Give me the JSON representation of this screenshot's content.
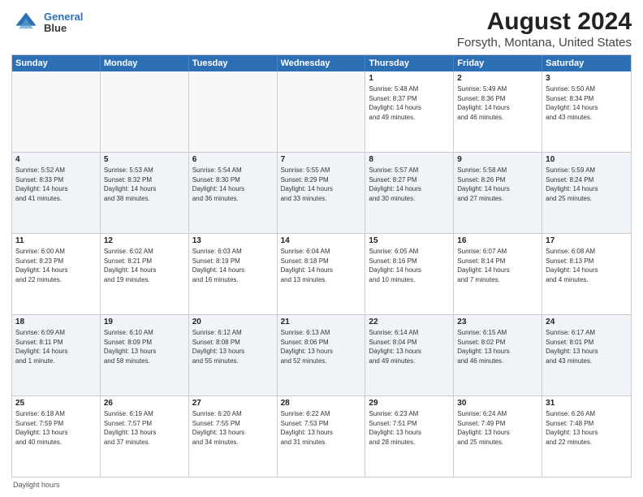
{
  "app": {
    "logo_line1": "General",
    "logo_line2": "Blue"
  },
  "title": "August 2024",
  "subtitle": "Forsyth, Montana, United States",
  "footer_note": "Daylight hours",
  "header_days": [
    "Sunday",
    "Monday",
    "Tuesday",
    "Wednesday",
    "Thursday",
    "Friday",
    "Saturday"
  ],
  "rows": [
    {
      "alt": false,
      "cells": [
        {
          "day": "",
          "empty": true,
          "info": ""
        },
        {
          "day": "",
          "empty": true,
          "info": ""
        },
        {
          "day": "",
          "empty": true,
          "info": ""
        },
        {
          "day": "",
          "empty": true,
          "info": ""
        },
        {
          "day": "1",
          "empty": false,
          "info": "Sunrise: 5:48 AM\nSunset: 8:37 PM\nDaylight: 14 hours\nand 49 minutes."
        },
        {
          "day": "2",
          "empty": false,
          "info": "Sunrise: 5:49 AM\nSunset: 8:36 PM\nDaylight: 14 hours\nand 46 minutes."
        },
        {
          "day": "3",
          "empty": false,
          "info": "Sunrise: 5:50 AM\nSunset: 8:34 PM\nDaylight: 14 hours\nand 43 minutes."
        }
      ]
    },
    {
      "alt": true,
      "cells": [
        {
          "day": "4",
          "empty": false,
          "info": "Sunrise: 5:52 AM\nSunset: 8:33 PM\nDaylight: 14 hours\nand 41 minutes."
        },
        {
          "day": "5",
          "empty": false,
          "info": "Sunrise: 5:53 AM\nSunset: 8:32 PM\nDaylight: 14 hours\nand 38 minutes."
        },
        {
          "day": "6",
          "empty": false,
          "info": "Sunrise: 5:54 AM\nSunset: 8:30 PM\nDaylight: 14 hours\nand 36 minutes."
        },
        {
          "day": "7",
          "empty": false,
          "info": "Sunrise: 5:55 AM\nSunset: 8:29 PM\nDaylight: 14 hours\nand 33 minutes."
        },
        {
          "day": "8",
          "empty": false,
          "info": "Sunrise: 5:57 AM\nSunset: 8:27 PM\nDaylight: 14 hours\nand 30 minutes."
        },
        {
          "day": "9",
          "empty": false,
          "info": "Sunrise: 5:58 AM\nSunset: 8:26 PM\nDaylight: 14 hours\nand 27 minutes."
        },
        {
          "day": "10",
          "empty": false,
          "info": "Sunrise: 5:59 AM\nSunset: 8:24 PM\nDaylight: 14 hours\nand 25 minutes."
        }
      ]
    },
    {
      "alt": false,
      "cells": [
        {
          "day": "11",
          "empty": false,
          "info": "Sunrise: 6:00 AM\nSunset: 8:23 PM\nDaylight: 14 hours\nand 22 minutes."
        },
        {
          "day": "12",
          "empty": false,
          "info": "Sunrise: 6:02 AM\nSunset: 8:21 PM\nDaylight: 14 hours\nand 19 minutes."
        },
        {
          "day": "13",
          "empty": false,
          "info": "Sunrise: 6:03 AM\nSunset: 8:19 PM\nDaylight: 14 hours\nand 16 minutes."
        },
        {
          "day": "14",
          "empty": false,
          "info": "Sunrise: 6:04 AM\nSunset: 8:18 PM\nDaylight: 14 hours\nand 13 minutes."
        },
        {
          "day": "15",
          "empty": false,
          "info": "Sunrise: 6:05 AM\nSunset: 8:16 PM\nDaylight: 14 hours\nand 10 minutes."
        },
        {
          "day": "16",
          "empty": false,
          "info": "Sunrise: 6:07 AM\nSunset: 8:14 PM\nDaylight: 14 hours\nand 7 minutes."
        },
        {
          "day": "17",
          "empty": false,
          "info": "Sunrise: 6:08 AM\nSunset: 8:13 PM\nDaylight: 14 hours\nand 4 minutes."
        }
      ]
    },
    {
      "alt": true,
      "cells": [
        {
          "day": "18",
          "empty": false,
          "info": "Sunrise: 6:09 AM\nSunset: 8:11 PM\nDaylight: 14 hours\nand 1 minute."
        },
        {
          "day": "19",
          "empty": false,
          "info": "Sunrise: 6:10 AM\nSunset: 8:09 PM\nDaylight: 13 hours\nand 58 minutes."
        },
        {
          "day": "20",
          "empty": false,
          "info": "Sunrise: 6:12 AM\nSunset: 8:08 PM\nDaylight: 13 hours\nand 55 minutes."
        },
        {
          "day": "21",
          "empty": false,
          "info": "Sunrise: 6:13 AM\nSunset: 8:06 PM\nDaylight: 13 hours\nand 52 minutes."
        },
        {
          "day": "22",
          "empty": false,
          "info": "Sunrise: 6:14 AM\nSunset: 8:04 PM\nDaylight: 13 hours\nand 49 minutes."
        },
        {
          "day": "23",
          "empty": false,
          "info": "Sunrise: 6:15 AM\nSunset: 8:02 PM\nDaylight: 13 hours\nand 46 minutes."
        },
        {
          "day": "24",
          "empty": false,
          "info": "Sunrise: 6:17 AM\nSunset: 8:01 PM\nDaylight: 13 hours\nand 43 minutes."
        }
      ]
    },
    {
      "alt": false,
      "cells": [
        {
          "day": "25",
          "empty": false,
          "info": "Sunrise: 6:18 AM\nSunset: 7:59 PM\nDaylight: 13 hours\nand 40 minutes."
        },
        {
          "day": "26",
          "empty": false,
          "info": "Sunrise: 6:19 AM\nSunset: 7:57 PM\nDaylight: 13 hours\nand 37 minutes."
        },
        {
          "day": "27",
          "empty": false,
          "info": "Sunrise: 6:20 AM\nSunset: 7:55 PM\nDaylight: 13 hours\nand 34 minutes."
        },
        {
          "day": "28",
          "empty": false,
          "info": "Sunrise: 6:22 AM\nSunset: 7:53 PM\nDaylight: 13 hours\nand 31 minutes."
        },
        {
          "day": "29",
          "empty": false,
          "info": "Sunrise: 6:23 AM\nSunset: 7:51 PM\nDaylight: 13 hours\nand 28 minutes."
        },
        {
          "day": "30",
          "empty": false,
          "info": "Sunrise: 6:24 AM\nSunset: 7:49 PM\nDaylight: 13 hours\nand 25 minutes."
        },
        {
          "day": "31",
          "empty": false,
          "info": "Sunrise: 6:26 AM\nSunset: 7:48 PM\nDaylight: 13 hours\nand 22 minutes."
        }
      ]
    }
  ]
}
